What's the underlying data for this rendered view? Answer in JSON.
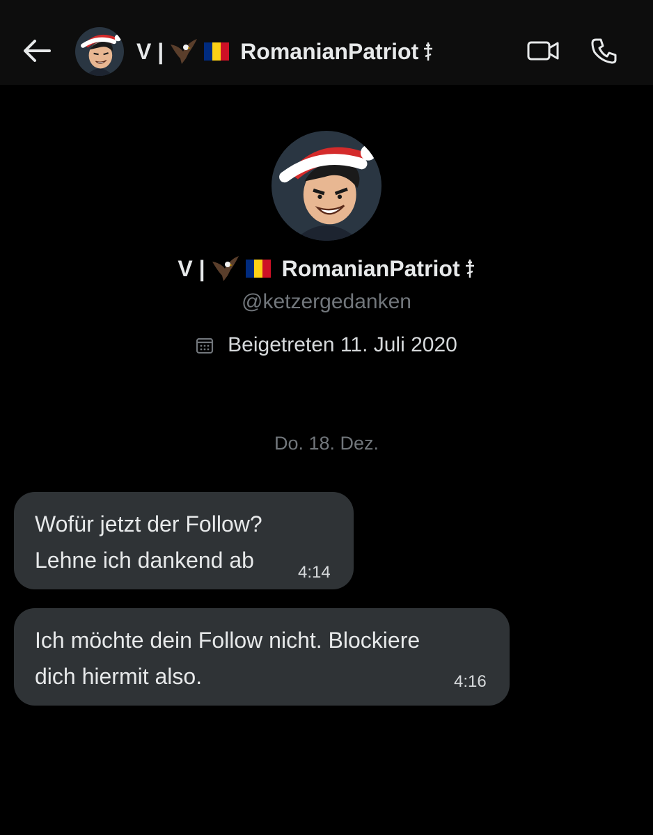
{
  "header": {
    "name_prefix": "V |",
    "name": "RomanianPatriot",
    "icons": {
      "back": "arrow-left-icon",
      "eagle": "eagle-emoji-icon",
      "flag": "romania-flag-icon",
      "cross": "orthodox-cross-icon",
      "video": "video-call-icon",
      "phone": "phone-call-icon"
    }
  },
  "profile": {
    "name_prefix": "V |",
    "name": "RomanianPatriot",
    "handle": "@ketzergedanken",
    "joined": "Beigetreten 11. Juli 2020",
    "joined_icon": "calendar-icon"
  },
  "date_separator": "Do. 18. Dez.",
  "messages": [
    {
      "text": "Wofür jetzt der Follow?\nLehne ich dankend ab",
      "time": "4:14"
    },
    {
      "text": "Ich möchte dein Follow nicht. Blockiere\ndich hiermit also.",
      "time": "4:16"
    }
  ],
  "colors": {
    "background": "#000000",
    "header_background": "#0d0d0d",
    "bubble": "#2f3336",
    "text_primary": "#e7e9ea",
    "text_secondary": "#71767b",
    "flag_blue": "#002b7f",
    "flag_yellow": "#fcd116",
    "flag_red": "#ce1126"
  }
}
